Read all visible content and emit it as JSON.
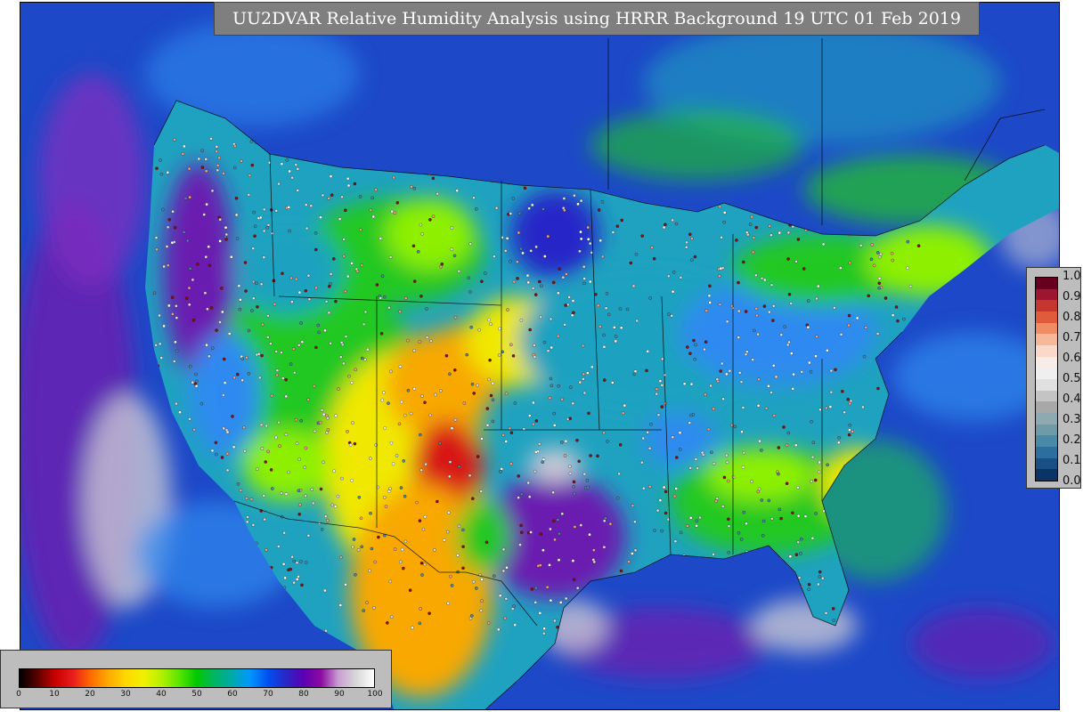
{
  "title": "UU2DVAR Relative Humidity Analysis using HRRR Background 19 UTC 01 Feb 2019",
  "rh_colorbar": {
    "ticks": [
      "0",
      "10",
      "20",
      "30",
      "40",
      "50",
      "60",
      "70",
      "80",
      "90",
      "100"
    ],
    "stops": [
      "#000000",
      "#5a0000",
      "#c80000",
      "#e81c1c",
      "#ff6a00",
      "#ffaa00",
      "#ffd800",
      "#f0f000",
      "#b4f000",
      "#5ae600",
      "#00c800",
      "#00b464",
      "#00aaaa",
      "#0096ff",
      "#0050f0",
      "#2828c8",
      "#5a00b4",
      "#8c0aa0",
      "#c8a0d2",
      "#d8d8d8",
      "#ffffff"
    ]
  },
  "weight_colorbar": {
    "ticks": [
      "1.0",
      "0.9",
      "0.8",
      "0.7",
      "0.6",
      "0.5",
      "0.4",
      "0.3",
      "0.2",
      "0.1",
      "0.0"
    ],
    "colors": [
      "#67001f",
      "#9e1530",
      "#c6362e",
      "#e05a3c",
      "#f08c64",
      "#f7b799",
      "#fbd9c9",
      "#f7ece6",
      "#efefef",
      "#e0e0e0",
      "#c4c4c4",
      "#a8a8a8",
      "#8ea9b0",
      "#6f9aa8",
      "#4a8aa8",
      "#2c6e9e",
      "#1a4f86",
      "#0b3363"
    ]
  },
  "palette": {
    "ocean": "#1d49c8",
    "ocean_light": "#2f8af0",
    "moist": "#6a1eb0",
    "moist_light": "#c8c8d4",
    "land_mid": "#1fa2c0",
    "land_green": "#22c822",
    "land_lime": "#8ef000",
    "land_yellow": "#f0e800",
    "land_orange": "#f8a800",
    "land_red": "#d81818",
    "boundary": "#000000"
  }
}
